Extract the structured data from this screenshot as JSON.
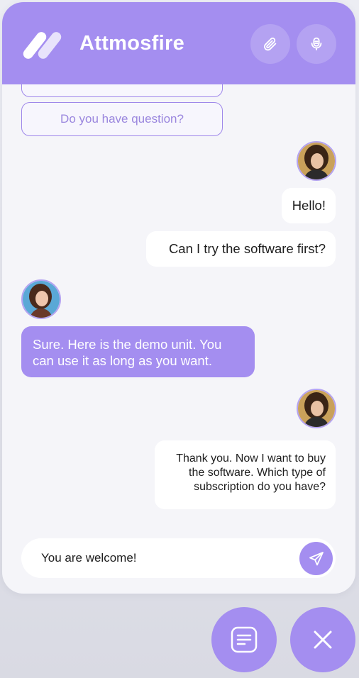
{
  "header": {
    "logo_icon": "attmosfire-logo-icon",
    "brand": "Attmosfire",
    "attach_icon": "paperclip-icon",
    "mic_icon": "microphone-icon"
  },
  "suggestions": [
    "",
    "Do you have question?"
  ],
  "messages": [
    {
      "sender": "user",
      "text": "Hello!"
    },
    {
      "sender": "user",
      "text": "Can I try the software first?"
    },
    {
      "sender": "agent",
      "text": "Sure. Here is the demo unit. You can use it as long as you want."
    },
    {
      "sender": "user",
      "text": "Thank you. Now I want to buy the software. Which type of subscription do you have?"
    }
  ],
  "composer": {
    "value": "You are welcome!",
    "send_icon": "send-icon"
  },
  "fabs": {
    "chat_icon": "chat-icon",
    "close_icon": "close-icon"
  },
  "colors": {
    "accent": "#a48ef0",
    "background": "#f5f5f9",
    "user_bubble": "#ffffff"
  }
}
